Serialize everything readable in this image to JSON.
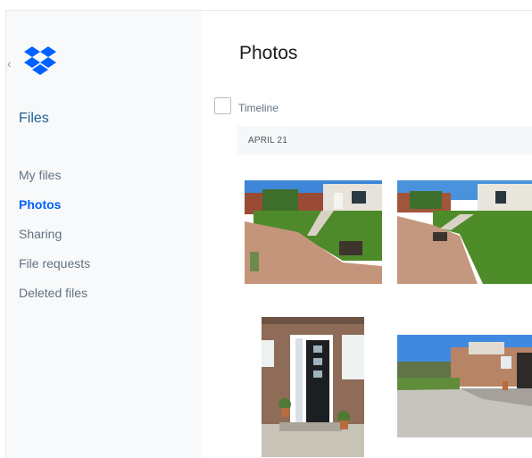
{
  "sidebar": {
    "title": "Files",
    "items": [
      {
        "label": "My files",
        "active": false
      },
      {
        "label": "Photos",
        "active": true
      },
      {
        "label": "Sharing",
        "active": false
      },
      {
        "label": "File requests",
        "active": false
      },
      {
        "label": "Deleted files",
        "active": false
      }
    ]
  },
  "main": {
    "title": "Photos",
    "timeline_label": "Timeline",
    "date_group": "APRIL 21"
  },
  "colors": {
    "brand_blue": "#0061fe",
    "sidebar_bg": "#f7f9fa",
    "active_nav": "#0061fe"
  },
  "icons": [
    "dropbox-logo-icon",
    "chevron-left-icon"
  ]
}
